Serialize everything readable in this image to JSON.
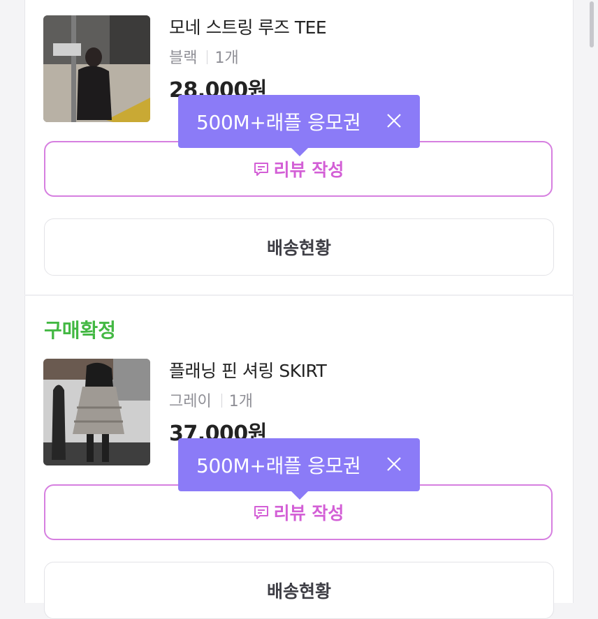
{
  "orders": [
    {
      "status": "",
      "product_name": "모네 스트링 루즈 TEE",
      "option": "블랙",
      "quantity": "1개",
      "price": "28,000원",
      "tooltip": "500M+래플 응모권",
      "review_button": "리뷰 작성",
      "shipping_button": "배송현황"
    },
    {
      "status": "구매확정",
      "product_name": "플래닝 핀 셔링 SKIRT",
      "option": "그레이",
      "quantity": "1개",
      "price": "37,000원",
      "tooltip": "500M+래플 응모권",
      "review_button": "리뷰 작성",
      "shipping_button": "배송현황"
    }
  ],
  "colors": {
    "review_accent": "#d35fd6",
    "tooltip_bg": "#8b7bf7",
    "status_green": "#43b843"
  },
  "icons": {
    "review": "review-comment-icon",
    "close": "close-icon"
  }
}
